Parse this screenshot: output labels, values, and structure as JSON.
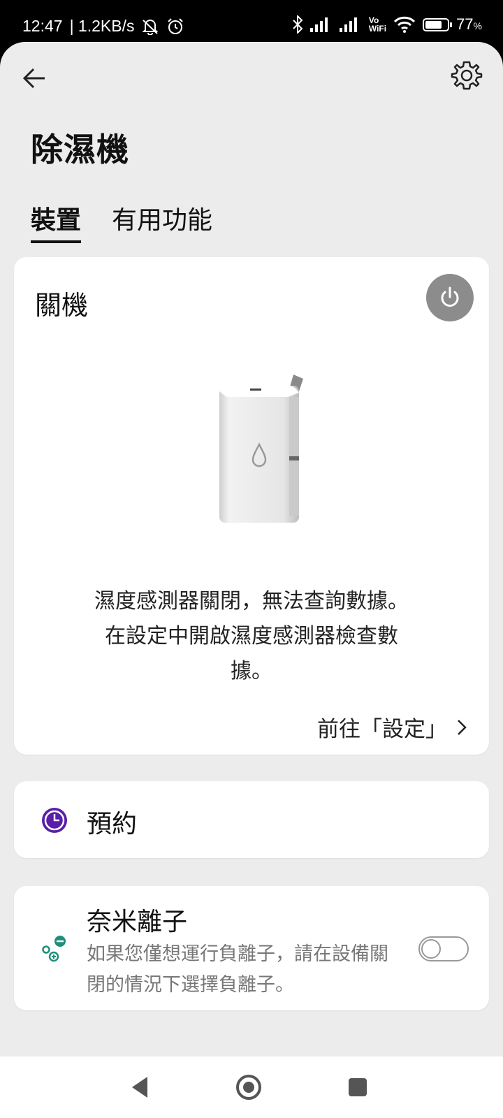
{
  "status_bar": {
    "time": "12:47",
    "network_speed": "| 1.2KB/s",
    "battery_percent": "77",
    "battery_unit": "%",
    "icons": [
      "notifications-off-icon",
      "alarm-icon",
      "bluetooth-icon",
      "signal-icon",
      "signal-icon",
      "vowifi-icon",
      "wifi-icon",
      "battery-icon"
    ],
    "vowifi_top": "Vo",
    "vowifi_bottom": "WiFi",
    "battery_level": 0.77
  },
  "header": {
    "title": "除濕機",
    "icons": [
      "back-arrow-icon",
      "gear-icon"
    ]
  },
  "tabs": [
    {
      "label": "裝置",
      "active": true
    },
    {
      "label": "有用功能",
      "active": false
    }
  ],
  "device_card": {
    "status": "關機",
    "message_line1": "濕度感測器關閉，無法查詢數據。",
    "message_line2": "在設定中開啟濕度感測器檢查數",
    "message_line3": "據。",
    "settings_link": "前往「設定」",
    "power_button_color": "#8c8c8c"
  },
  "schedule_card": {
    "label": "預約",
    "icon_color": "#5a1ea8"
  },
  "ion_card": {
    "title": "奈米離子",
    "description": "如果您僅想運行負離子，請在設備關閉的情況下選擇負離子。",
    "toggle_on": false,
    "icon_color": "#1f8f7c"
  },
  "nav_bar": {
    "icons": [
      "nav-back-icon",
      "nav-home-icon",
      "nav-recents-icon"
    ]
  }
}
